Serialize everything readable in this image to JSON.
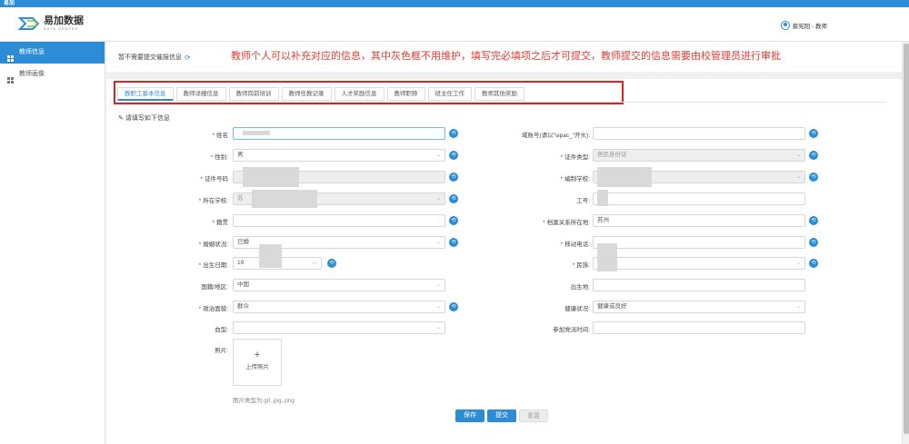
{
  "topbar": {
    "title": "易加"
  },
  "brand": {
    "name": "易加数据",
    "sub": "DATA CENTER"
  },
  "user": {
    "label": "蔡宪阳 - 教师"
  },
  "sidebar": {
    "items": [
      {
        "label": "教师信息"
      },
      {
        "label": "教师画像"
      }
    ]
  },
  "notice": {
    "text": "暂不需要提交催报信息"
  },
  "annotation": "教师个人可以补充对应的信息，其中灰色框不用维护，填写完必填项之后才可提交，教师提交的信息需要由校管理员进行审批",
  "tabs": [
    {
      "label": "教职工基本信息"
    },
    {
      "label": "教师详细信息"
    },
    {
      "label": "教师岗前培训"
    },
    {
      "label": "教师任教记录"
    },
    {
      "label": "人才奖励信息"
    },
    {
      "label": "教师职称"
    },
    {
      "label": "班主任工作"
    },
    {
      "label": "教师其他奖励"
    }
  ],
  "form": {
    "hint": "请填写如下信息",
    "left": [
      {
        "label": "姓名",
        "required": true,
        "value": ""
      },
      {
        "label": "性别",
        "required": true,
        "value": "男"
      },
      {
        "label": "证件号码",
        "required": true,
        "value": ""
      },
      {
        "label": "所在学校",
        "required": true,
        "value": "苏"
      },
      {
        "label": "籍贯",
        "required": true,
        "value": ""
      },
      {
        "label": "婚姻状况",
        "required": true,
        "value": "已婚"
      },
      {
        "label": "出生日期",
        "required": true,
        "value": "19"
      },
      {
        "label": "国籍/地区",
        "required": false,
        "value": "中国"
      },
      {
        "label": "政治面貌",
        "required": true,
        "value": "群众"
      },
      {
        "label": "血型",
        "required": false,
        "value": ""
      },
      {
        "label": "照片",
        "required": false,
        "value": ""
      }
    ],
    "right": [
      {
        "label": "域账号(请以\"sipac_\"开头)",
        "required": false,
        "value": ""
      },
      {
        "label": "证件类型",
        "required": true,
        "value": "居民身份证"
      },
      {
        "label": "编制学校",
        "required": true,
        "value": ""
      },
      {
        "label": "工号",
        "required": false,
        "value": ""
      },
      {
        "label": "档案关系所在地",
        "required": true,
        "value": "苏州"
      },
      {
        "label": "移动电话",
        "required": true,
        "value": ""
      },
      {
        "label": "民族",
        "required": true,
        "value": ""
      },
      {
        "label": "出生地",
        "required": false,
        "value": ""
      },
      {
        "label": "健康状况",
        "required": false,
        "value": "健康或良好"
      },
      {
        "label": "参加党派时间",
        "required": false,
        "value": ""
      }
    ],
    "photo": {
      "plus": "+",
      "label": "上传照片",
      "hint": "图片类型为.gif,.jpg,.png"
    }
  },
  "buttons": {
    "save": "保存",
    "submit": "提交",
    "reset": "重置"
  }
}
